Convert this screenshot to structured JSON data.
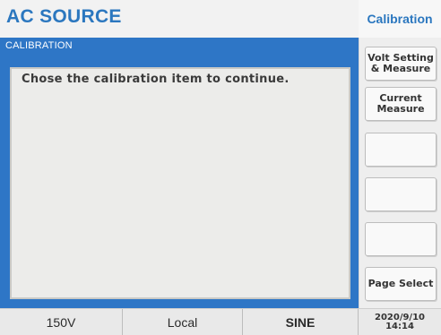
{
  "header": {
    "app_title": "AC SOURCE",
    "mode_title": "Calibration"
  },
  "panel": {
    "label": "CALIBRATION",
    "message": "Chose the calibration item to continue."
  },
  "softkeys": [
    {
      "label": "Volt Setting\n& Measure"
    },
    {
      "label": "Current\nMeasure"
    },
    {
      "label": ""
    },
    {
      "label": ""
    },
    {
      "label": ""
    },
    {
      "label": "Page Select"
    }
  ],
  "status": {
    "range": "150V",
    "control": "Local",
    "waveform": "SINE",
    "date": "2020/9/10",
    "time": "14:14"
  },
  "colors": {
    "accent_blue": "#2e76c6",
    "title_blue": "#2b77bf"
  }
}
